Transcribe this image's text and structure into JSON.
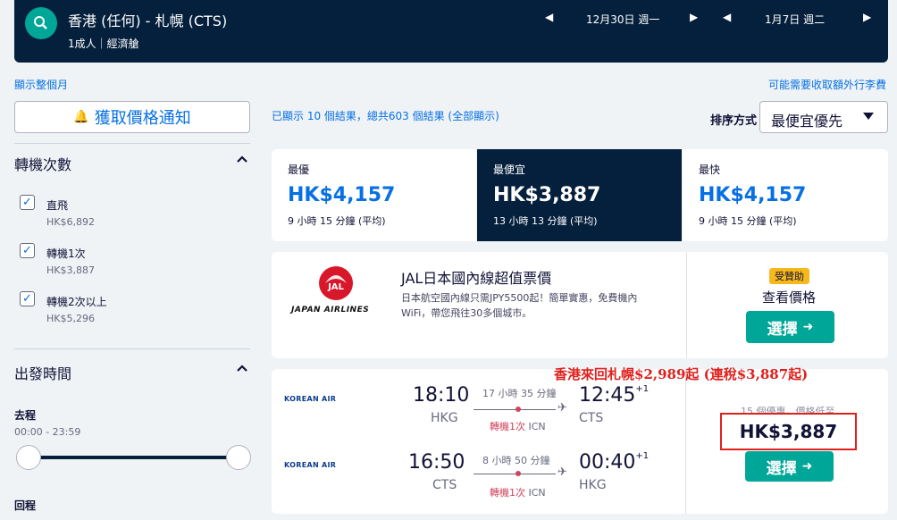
{
  "header": {
    "route": "香港 (任何) - 札幌 (CTS)",
    "passengers": "1成人｜經濟艙",
    "outbound_date": "12月30日 週一",
    "return_date": "1月7日 週二"
  },
  "links": {
    "show_month": "顯示整個月",
    "extra_fees": "可能需要收取額外行李費"
  },
  "filters": {
    "price_alert": "獲取價格通知",
    "stops_title": "轉機次數",
    "stops": [
      {
        "label": "直飛",
        "price": "HK$6,892",
        "checked": true
      },
      {
        "label": "轉機1次",
        "price": "HK$3,887",
        "checked": true
      },
      {
        "label": "轉機2次以上",
        "price": "HK$5,296",
        "checked": true
      }
    ],
    "departure_title": "出發時間",
    "outbound_label": "去程",
    "outbound_range": "00:00 - 23:59",
    "return_label": "回程"
  },
  "results": {
    "count_text": "已顯示 10 個結果，總共603 個結果 (全部顯示)",
    "sort_label": "排序方式",
    "sort_value": "最便宜優先",
    "tabs": [
      {
        "title": "最優",
        "price": "HK$4,157",
        "duration": "9 小時 15 分鐘 (平均)"
      },
      {
        "title": "最便宜",
        "price": "HK$3,887",
        "duration": "13 小時 13 分鐘 (平均)"
      },
      {
        "title": "最快",
        "price": "HK$4,157",
        "duration": "9 小時 15 分鐘 (平均)"
      }
    ]
  },
  "ad": {
    "airline_name": "JAPAN AIRLINES",
    "logo_text": "JAL",
    "title": "JAL日本國內線超值票價",
    "desc": "日本航空國內線只需JPY5500起！簡單實惠，免費機內WiFi，帶您飛往30多個城市。",
    "badge": "受贊助",
    "cta": "查看價格",
    "button": "選擇"
  },
  "flight": {
    "annotation": "香港來回札幌$2,989起 (連稅$3,887起)",
    "airline": "KOREAN AIR",
    "legs": [
      {
        "dep_time": "18:10",
        "dep_code": "HKG",
        "duration": "17 小時 35 分鐘",
        "stops": "轉機1次",
        "via": "ICN",
        "arr_time": "12:45",
        "day_offset": "+1",
        "arr_code": "CTS"
      },
      {
        "dep_time": "16:50",
        "dep_code": "CTS",
        "duration": "8 小時 50 分鐘",
        "stops": "轉機1次",
        "via": "ICN",
        "arr_time": "00:40",
        "day_offset": "+1",
        "arr_code": "HKG"
      }
    ],
    "deals": "15 個優惠，價格低至",
    "price": "HK$3,887",
    "button": "選擇"
  },
  "colors": {
    "navy": "#05203c",
    "accent": "#0770e3",
    "green": "#00a698",
    "annotation_red": "#e0201d"
  }
}
